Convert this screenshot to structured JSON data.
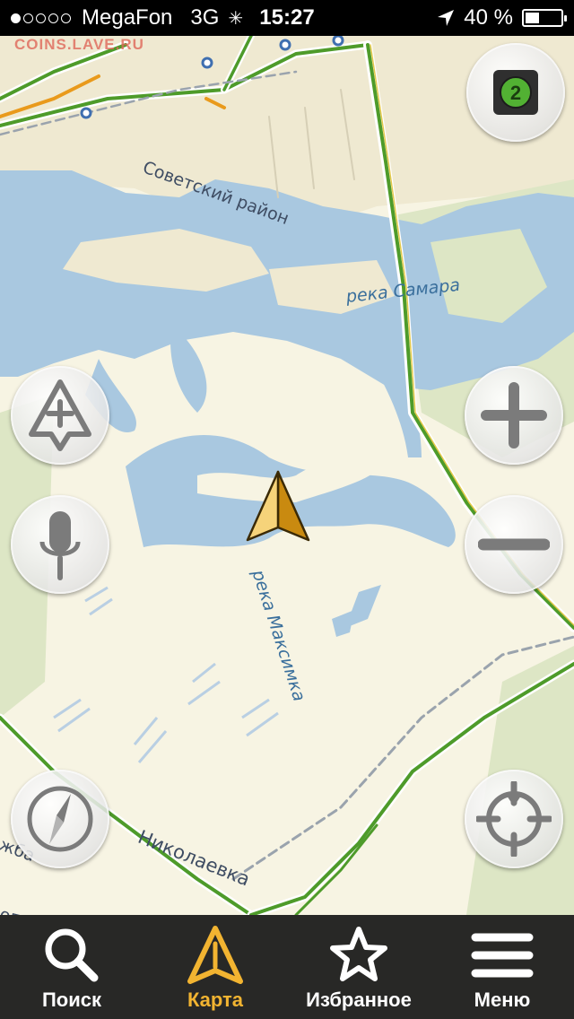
{
  "status_bar": {
    "carrier": "MegaFon",
    "network": "3G",
    "time": "15:27",
    "battery": "40 %",
    "battery_level": 0.4,
    "signal_bars": 1,
    "signal_total": 5
  },
  "map": {
    "watermark": "COINS.LAVE.RU",
    "labels": {
      "district": "Советский район",
      "river_samara": "река Самара",
      "river_maksimka": "река Максимка",
      "village": "Николаевка",
      "edge_left_1": "жба",
      "edge_left_2": "опатинский"
    }
  },
  "controls": {
    "layers_count": "2"
  },
  "tabs": [
    {
      "label": "Поиск",
      "icon": "search-icon",
      "active": false
    },
    {
      "label": "Карта",
      "icon": "map-arrow-icon",
      "active": true
    },
    {
      "label": "Избранное",
      "icon": "star-icon",
      "active": false
    },
    {
      "label": "Меню",
      "icon": "menu-icon",
      "active": false
    }
  ],
  "colors": {
    "accent": "#f2b431",
    "water": "#a9c8e0",
    "traffic_green": "#4e9b2a",
    "traffic_orange": "#e99a1c"
  }
}
